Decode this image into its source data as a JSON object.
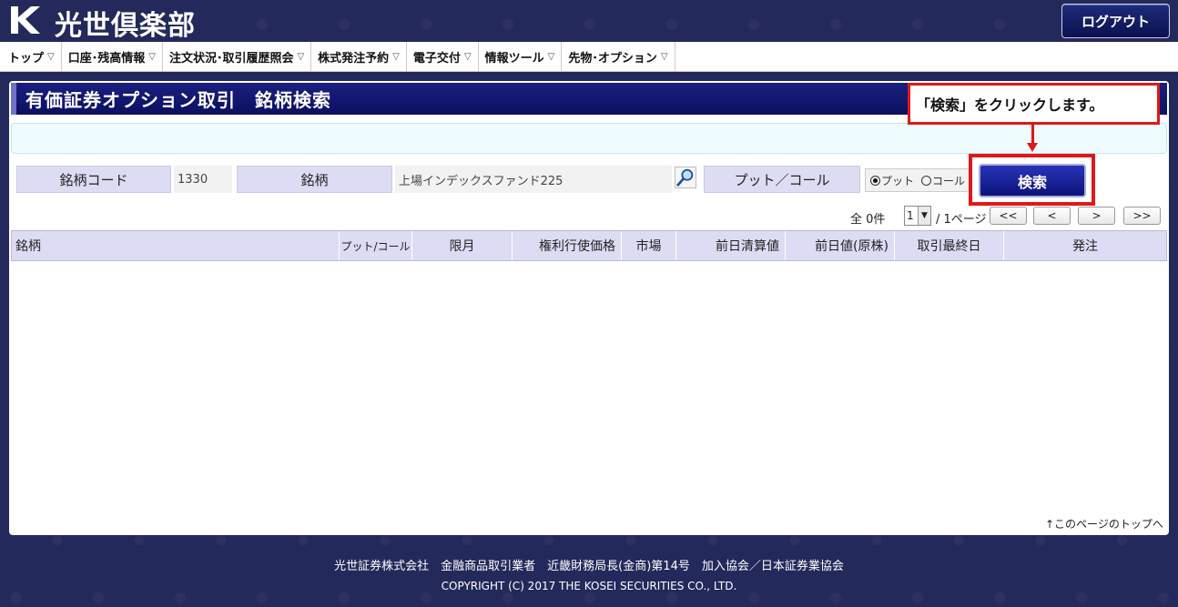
{
  "header": {
    "logo_text": "光世倶楽部",
    "logout_label": "ログアウト"
  },
  "nav": {
    "items": [
      {
        "label": "トップ"
      },
      {
        "label": "口座･残高情報"
      },
      {
        "label": "注文状況･取引履歴照会"
      },
      {
        "label": "株式発注予約"
      },
      {
        "label": "電子交付"
      },
      {
        "label": "情報ツール"
      },
      {
        "label": "先物･オプション"
      }
    ]
  },
  "page": {
    "title": "有価証券オプション取引　銘柄検索"
  },
  "search": {
    "code_label": "銘柄コード",
    "code_value": "1330",
    "name_label": "銘柄",
    "name_value": "上場インデックスファンド225",
    "putcall_label": "プット／コール",
    "put_label": "プット",
    "call_label": "コール",
    "selected": "put",
    "search_button": "検索"
  },
  "annotation": {
    "callout_text": "「検索」をクリックします。",
    "color": "#e01818"
  },
  "pager": {
    "total": "全 0件",
    "page_value": "1",
    "page_suffix": "/ 1ページ",
    "first": "<<",
    "prev": "<",
    "next": ">",
    "last": ">>"
  },
  "table": {
    "headers": [
      "銘柄",
      "プット/コール",
      "限月",
      "権利行使価格",
      "市場",
      "前日清算値",
      "前日値(原株)",
      "取引最終日",
      "発注"
    ]
  },
  "links": {
    "back_to_top": "↑このページのトップへ"
  },
  "footer": {
    "line1": "光世証券株式会社　金融商品取引業者　近畿財務局長(金商)第14号　加入協会／日本証券業協会",
    "line2": "COPYRIGHT (C) 2017 THE KOSEI SECURITIES CO., LTD."
  },
  "colors": {
    "brand_navy": "#0c1060",
    "background": "#23295a",
    "label_bg": "#dcdcf4"
  }
}
